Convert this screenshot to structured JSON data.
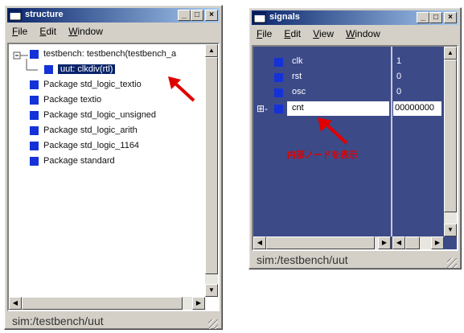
{
  "structure": {
    "title": "structure",
    "menu": [
      "File",
      "Edit",
      "Window"
    ],
    "tree": [
      {
        "label": "testbench: testbench(testbench_a"
      },
      {
        "label": "uut: clkdiv(rtl)",
        "selected": true
      },
      {
        "label": "Package std_logic_textio"
      },
      {
        "label": "Package textio"
      },
      {
        "label": "Package std_logic_unsigned"
      },
      {
        "label": "Package std_logic_arith"
      },
      {
        "label": "Package std_logic_1164"
      },
      {
        "label": "Package standard"
      }
    ],
    "status": "sim:/testbench/uut",
    "buttons": {
      "minimize": "_",
      "maximize": "□",
      "close": "×"
    }
  },
  "signals": {
    "title": "signals",
    "menu": [
      "File",
      "Edit",
      "View",
      "Window"
    ],
    "rows": [
      {
        "name": "clk",
        "value": "1"
      },
      {
        "name": "rst",
        "value": "0"
      },
      {
        "name": "osc",
        "value": "0"
      },
      {
        "name": "cnt",
        "value": "00000000",
        "expand": "⊞-",
        "highlighted": true
      }
    ],
    "annotation": "内部ノードを表示",
    "status": "sim:/testbench/uut",
    "buttons": {
      "minimize": "_",
      "maximize": "□",
      "close": "×"
    }
  },
  "colors": {
    "titlebar": "#0a246a",
    "signal_bg": "#3c4a88",
    "icon": "#1432d8",
    "arrow": "#e00000"
  }
}
